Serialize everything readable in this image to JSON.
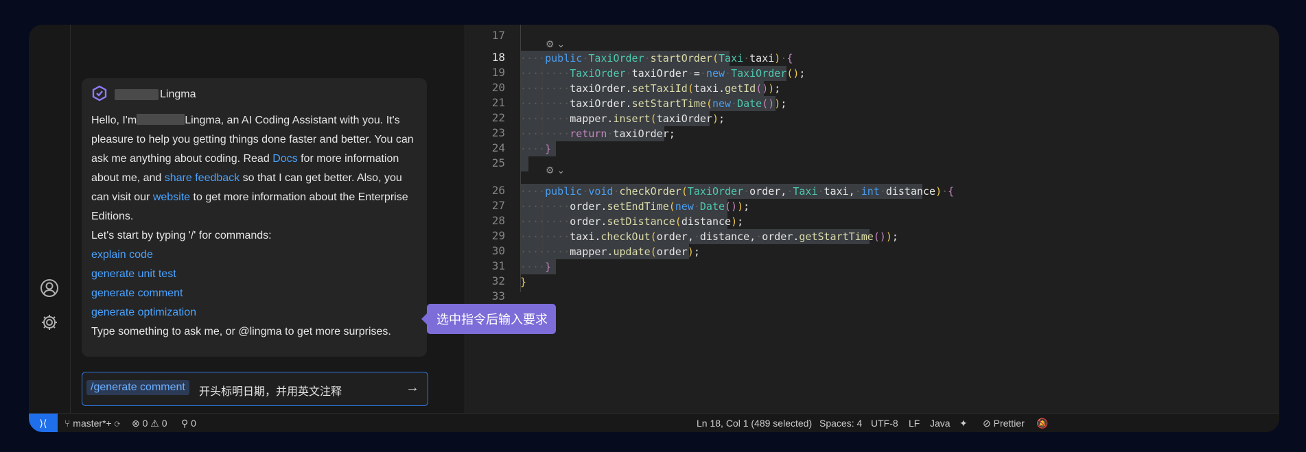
{
  "chat": {
    "assistant_name": "Lingma",
    "greeting_pre": "Hello, I'm",
    "greeting_post": "Lingma, an AI Coding Assistant with you. It's pleasure to help you getting things done faster and better. You can ask me anything about coding. Read",
    "docs_link": "Docs",
    "text_after_docs": "for more information about me, and",
    "feedback_link": "share feedback",
    "text_after_feedback": "so that I can get better. Also, you can visit our",
    "website_link": "website",
    "text_after_website": "to get more information about the Enterprise Editions.",
    "start_hint": "Let's start by typing '/' for commands:",
    "commands": [
      "explain code",
      "generate unit test",
      "generate comment",
      "generate optimization"
    ],
    "footer_hint": "Type something to ask me, or @lingma to get more surprises.",
    "input_command": "/generate comment",
    "input_value": "开头标明日期，并用英文注释",
    "send_icon": "→"
  },
  "tooltip": {
    "text": "选中指令后输入要求"
  },
  "editor": {
    "line_numbers": [
      "17",
      "18",
      "19",
      "20",
      "21",
      "22",
      "23",
      "24",
      "25",
      "26",
      "27",
      "28",
      "29",
      "30",
      "31",
      "32",
      "33"
    ],
    "codelens_icon": "lingma-codelens-icon"
  },
  "statusbar": {
    "branch": "master*+",
    "errors": "0",
    "warnings": "0",
    "ports": "0",
    "position": "Ln 18, Col 1 (489 selected)",
    "spaces": "Spaces: 4",
    "encoding": "UTF-8",
    "eol": "LF",
    "language": "Java",
    "formatter": "Prettier"
  },
  "colors": {
    "accent": "#1f6feb",
    "tooltip": "#7c6dd8",
    "link": "#4aa3ff"
  }
}
